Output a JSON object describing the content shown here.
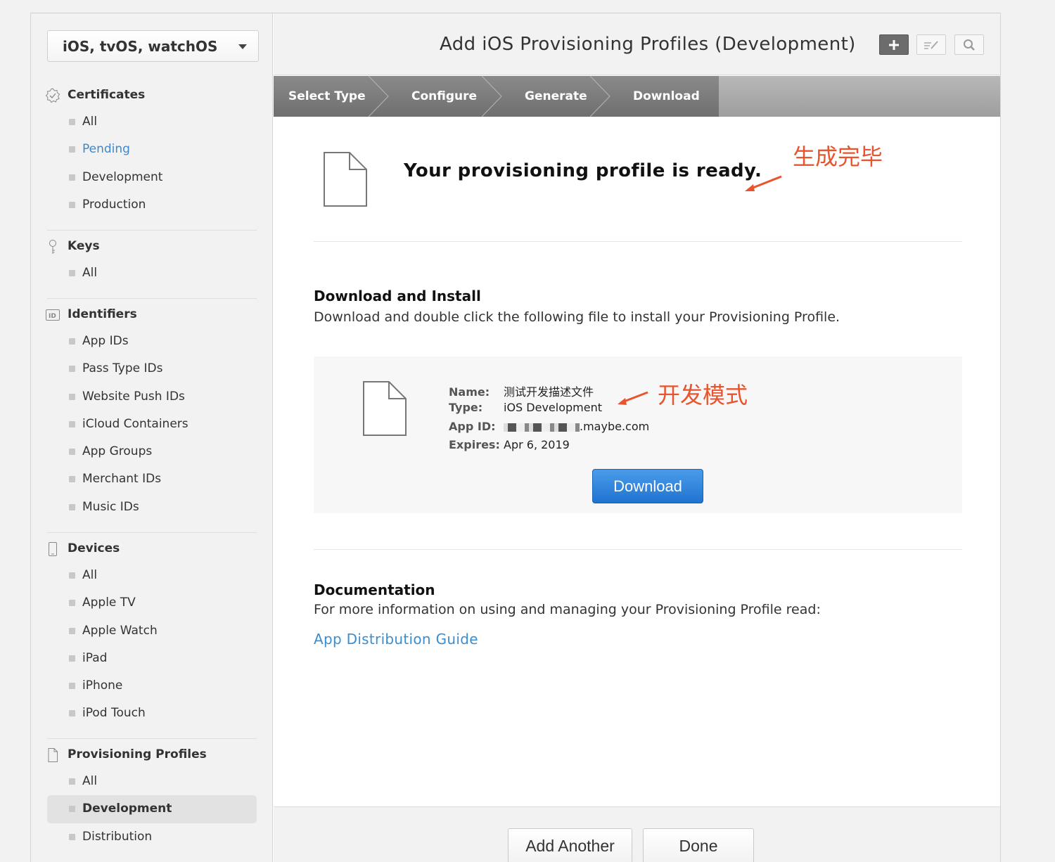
{
  "sidebar": {
    "platform": "iOS, tvOS, watchOS",
    "certificates": {
      "title": "Certificates",
      "items": [
        "All",
        "Pending",
        "Development",
        "Production"
      ]
    },
    "keys": {
      "title": "Keys",
      "items": [
        "All"
      ]
    },
    "identifiers": {
      "title": "Identifiers",
      "items": [
        "App IDs",
        "Pass Type IDs",
        "Website Push IDs",
        "iCloud Containers",
        "App Groups",
        "Merchant IDs",
        "Music IDs"
      ]
    },
    "devices": {
      "title": "Devices",
      "items": [
        "All",
        "Apple TV",
        "Apple Watch",
        "iPad",
        "iPhone",
        "iPod Touch"
      ]
    },
    "profiles": {
      "title": "Provisioning Profiles",
      "items": [
        "All",
        "Development",
        "Distribution"
      ]
    }
  },
  "header": {
    "title": "Add iOS Provisioning Profiles (Development)"
  },
  "steps": [
    "Select Type",
    "Configure",
    "Generate",
    "Download"
  ],
  "main": {
    "ready": "Your provisioning profile is ready.",
    "annotation_ready": "生成完毕",
    "install_heading": "Download and Install",
    "install_text": "Download and double click the following file to install your Provisioning Profile.",
    "profile": {
      "name_label": "Name:",
      "name_value": "测试开发描述文件",
      "type_label": "Type:",
      "type_value": "iOS Development",
      "appid_label": "App ID:",
      "appid_value": ".maybe.com",
      "expires_label": "Expires:",
      "expires_value": "Apr 6, 2019"
    },
    "annotation_type": "开发模式",
    "download_label": "Download",
    "doc_heading": "Documentation",
    "doc_text": "For more information on using and managing your Provisioning Profile read:",
    "doc_link": "App Distribution Guide"
  },
  "footer": {
    "add_another": "Add Another",
    "done": "Done"
  },
  "colors": {
    "accent": "#3a8ed0",
    "annotation": "#e8542d",
    "button": "#1f73cf"
  }
}
